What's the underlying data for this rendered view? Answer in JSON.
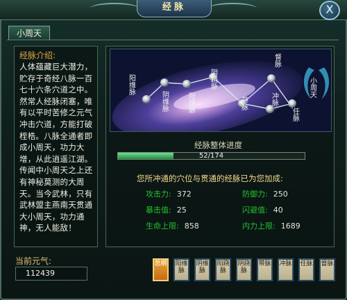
{
  "window": {
    "title": "经脉",
    "close_label": "X"
  },
  "tabs": [
    {
      "label": "小周天",
      "active": true
    }
  ],
  "intro": {
    "title": "经脉介绍:",
    "text": "人体蕴藏巨大潜力，贮存于奇经八脉一百七十六条穴道之中。然常人经脉闭塞，唯有以平时苦修之元气冲击穴道，方能打破桎梏。八脉全通者即成小周天，功力大增，从此逍遥江湖。传闻中小周天之上还有神秘莫测的大周天。当今武林，只有武林盟主燕南天贯通大小周天，功力通神，无人能敌！"
  },
  "qi": {
    "label": "当前元气:",
    "value": "112439"
  },
  "meridian_map": {
    "emblem": "小周天",
    "nodes": [
      {
        "label": "阳维脉"
      },
      {
        "label": "阴维脉"
      },
      {
        "label": "阳跷脉"
      },
      {
        "label": "阴跷脉"
      },
      {
        "label": "带脉"
      },
      {
        "label": "督脉"
      },
      {
        "label": "冲脉"
      },
      {
        "label": "任脉"
      }
    ]
  },
  "progress": {
    "title": "经脉整体进度",
    "text": "52/174",
    "current": 52,
    "total": 174
  },
  "bonus": {
    "title": "您所冲通的穴位与贯通的经脉已为您加成:",
    "stats": [
      {
        "label": "攻击力",
        "value": "372"
      },
      {
        "label": "防御力",
        "value": "250"
      },
      {
        "label": "暴击值",
        "value": "25"
      },
      {
        "label": "闪避值",
        "value": "40"
      },
      {
        "label": "生命上限",
        "value": "858"
      },
      {
        "label": "内力上限",
        "value": "1689"
      }
    ]
  },
  "slots": [
    {
      "label": "总纲",
      "active": true
    },
    {
      "label": "阳维脉",
      "active": false
    },
    {
      "label": "阴维脉",
      "active": false
    },
    {
      "label": "阳跷脉",
      "active": false
    },
    {
      "label": "阴跷脉",
      "active": false
    },
    {
      "label": "带脉",
      "active": false
    },
    {
      "label": "冲脉",
      "active": false
    },
    {
      "label": "任脉",
      "active": false
    },
    {
      "label": "督脉",
      "active": false
    }
  ]
}
